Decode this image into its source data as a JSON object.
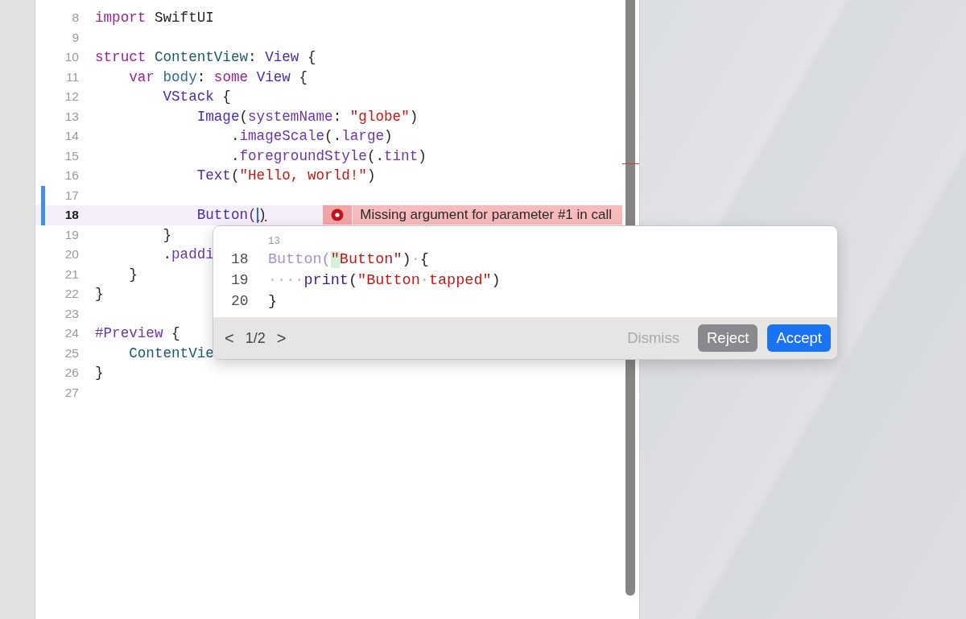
{
  "editor": {
    "lines": [
      {
        "number": "8",
        "current": false,
        "changed": false,
        "tokens": [
          {
            "kind": "keyword",
            "text": "import"
          },
          {
            "kind": "plain",
            "text": " SwiftUI"
          }
        ]
      },
      {
        "number": "9",
        "current": false,
        "changed": false
      },
      {
        "number": "10",
        "current": false,
        "changed": false,
        "tokens": [
          {
            "kind": "keyword",
            "text": "struct "
          },
          {
            "kind": "decl",
            "text": "ContentView"
          },
          {
            "kind": "plain",
            "text": ": "
          },
          {
            "kind": "type",
            "text": "View"
          },
          {
            "kind": "plain",
            "text": " {"
          }
        ]
      },
      {
        "number": "11",
        "current": false,
        "changed": false,
        "tokens": [
          {
            "kind": "keyword",
            "text": "    var "
          },
          {
            "kind": "property",
            "text": "body"
          },
          {
            "kind": "plain",
            "text": ": "
          },
          {
            "kind": "keyword",
            "text": "some "
          },
          {
            "kind": "type",
            "text": "View"
          },
          {
            "kind": "plain",
            "text": " {"
          }
        ]
      },
      {
        "number": "12",
        "current": false,
        "changed": false,
        "tokens": [
          {
            "kind": "type",
            "text": "        VStack"
          },
          {
            "kind": "plain",
            "text": " {"
          }
        ]
      },
      {
        "number": "13",
        "current": false,
        "changed": false,
        "tokens": [
          {
            "kind": "type",
            "text": "            Image"
          },
          {
            "kind": "plain",
            "text": "("
          },
          {
            "kind": "member",
            "text": "systemName"
          },
          {
            "kind": "plain",
            "text": ": "
          },
          {
            "kind": "string",
            "text": "\"globe\""
          },
          {
            "kind": "plain",
            "text": ")"
          }
        ]
      },
      {
        "number": "14",
        "current": false,
        "changed": false,
        "tokens": [
          {
            "kind": "plain",
            "text": "                ."
          },
          {
            "kind": "member",
            "text": "imageScale"
          },
          {
            "kind": "plain",
            "text": "(."
          },
          {
            "kind": "member",
            "text": "large"
          },
          {
            "kind": "plain",
            "text": ")"
          }
        ]
      },
      {
        "number": "15",
        "current": false,
        "changed": false,
        "tokens": [
          {
            "kind": "plain",
            "text": "                ."
          },
          {
            "kind": "member",
            "text": "foregroundStyle"
          },
          {
            "kind": "plain",
            "text": "(."
          },
          {
            "kind": "member",
            "text": "tint"
          },
          {
            "kind": "plain",
            "text": ")"
          }
        ]
      },
      {
        "number": "16",
        "current": false,
        "changed": false,
        "tokens": [
          {
            "kind": "type",
            "text": "            Text"
          },
          {
            "kind": "plain",
            "text": "("
          },
          {
            "kind": "string",
            "text": "\"Hello, world!\""
          },
          {
            "kind": "plain",
            "text": ")"
          }
        ]
      },
      {
        "number": "17",
        "current": false,
        "changed": true
      },
      {
        "number": "18",
        "current": true,
        "changed": true,
        "tokens": [
          {
            "kind": "type",
            "text": "            Button("
          },
          {
            "kind": "cursor"
          },
          {
            "kind": "error",
            "text": ")"
          }
        ],
        "issue": {
          "message": "Missing argument for parameter #1 in call"
        }
      },
      {
        "number": "19",
        "current": false,
        "changed": false,
        "tokens": [
          {
            "kind": "plain",
            "text": "        }"
          }
        ]
      },
      {
        "number": "20",
        "current": false,
        "changed": false,
        "tokens": [
          {
            "kind": "plain",
            "text": "        ."
          },
          {
            "kind": "member",
            "text": "paddi"
          }
        ]
      },
      {
        "number": "21",
        "current": false,
        "changed": false,
        "tokens": [
          {
            "kind": "plain",
            "text": "    }"
          }
        ]
      },
      {
        "number": "22",
        "current": false,
        "changed": false,
        "tokens": [
          {
            "kind": "plain",
            "text": "}"
          }
        ]
      },
      {
        "number": "23",
        "current": false,
        "changed": false
      },
      {
        "number": "24",
        "current": false,
        "changed": false,
        "tokens": [
          {
            "kind": "member",
            "text": "#Preview"
          },
          {
            "kind": "plain",
            "text": " {"
          }
        ]
      },
      {
        "number": "25",
        "current": false,
        "changed": false,
        "tokens": [
          {
            "kind": "decl",
            "text": "    ContentVie"
          }
        ]
      },
      {
        "number": "26",
        "current": false,
        "changed": false,
        "tokens": [
          {
            "kind": "plain",
            "text": "}"
          }
        ]
      },
      {
        "number": "27",
        "current": false,
        "changed": false
      }
    ]
  },
  "suggestion": {
    "context_line": "13",
    "lines": [
      {
        "number": "18",
        "tokens": [
          {
            "kind": "faded",
            "text": "Button("
          },
          {
            "kind": "string",
            "text": "\"",
            "inserted": true
          },
          {
            "kind": "string",
            "text": "Button\""
          },
          {
            "kind": "plain",
            "text": ")"
          },
          {
            "kind": "space",
            "text": "·"
          },
          {
            "kind": "plain",
            "text": "{"
          }
        ]
      },
      {
        "number": "19",
        "tokens": [
          {
            "kind": "space",
            "text": "····"
          },
          {
            "kind": "call",
            "text": "print"
          },
          {
            "kind": "plain",
            "text": "("
          },
          {
            "kind": "string",
            "text": "\"Button"
          },
          {
            "kind": "space",
            "text": "·"
          },
          {
            "kind": "string",
            "text": "tapped\""
          },
          {
            "kind": "plain",
            "text": ")"
          }
        ]
      },
      {
        "number": "20",
        "tokens": [
          {
            "kind": "plain",
            "text": "}"
          }
        ]
      }
    ],
    "pager": {
      "previous": "<",
      "position": "1/2",
      "next": ">"
    },
    "buttons": [
      {
        "label": "Dismiss",
        "kind": "plain"
      },
      {
        "label": "Reject",
        "kind": "secondary"
      },
      {
        "label": "Accept",
        "kind": "primary"
      }
    ]
  }
}
